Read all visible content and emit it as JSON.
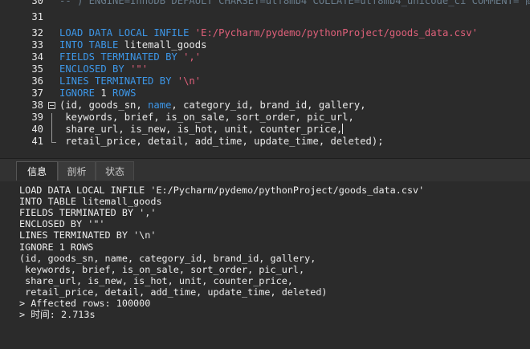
{
  "editor": {
    "lines": [
      {
        "num": "30",
        "segments": [
          {
            "t": "-- ) ENGINE=InnoDB DEFAULT CHARSET=utf8mb4 COLLATE=utf8mb4_unicode_ci COMMENT='商品表';",
            "c": "cmt"
          }
        ]
      },
      {
        "num": "31",
        "segments": []
      },
      {
        "num": "32",
        "segments": [
          {
            "t": "LOAD DATA LOCAL INFILE ",
            "c": "kw"
          },
          {
            "t": "'E:/Pycharm/pydemo/pythonProject/goods_data.csv'",
            "c": "str"
          }
        ]
      },
      {
        "num": "33",
        "segments": [
          {
            "t": "INTO TABLE ",
            "c": "kw"
          },
          {
            "t": "litemall_goods",
            "c": "plain"
          }
        ]
      },
      {
        "num": "34",
        "segments": [
          {
            "t": "FIELDS TERMINATED BY ",
            "c": "kw"
          },
          {
            "t": "','",
            "c": "str"
          }
        ]
      },
      {
        "num": "35",
        "segments": [
          {
            "t": "ENCLOSED BY ",
            "c": "kw"
          },
          {
            "t": "'\"'",
            "c": "str"
          }
        ]
      },
      {
        "num": "36",
        "segments": [
          {
            "t": "LINES TERMINATED BY ",
            "c": "kw"
          },
          {
            "t": "'\\n'",
            "c": "str"
          }
        ]
      },
      {
        "num": "37",
        "segments": [
          {
            "t": "IGNORE ",
            "c": "kw"
          },
          {
            "t": "1",
            "c": "num"
          },
          {
            "t": " ROWS",
            "c": "kw"
          }
        ]
      },
      {
        "num": "38",
        "segments": [
          {
            "t": "(id, goods_sn, ",
            "c": "plain"
          },
          {
            "t": "name",
            "c": "kw"
          },
          {
            "t": ", category_id, brand_id, gallery,",
            "c": "plain"
          }
        ]
      },
      {
        "num": "39",
        "segments": [
          {
            "t": " keywords, brief, is_on_sale, sort_order, pic_url,",
            "c": "plain"
          }
        ]
      },
      {
        "num": "40",
        "segments": [
          {
            "t": " share_url, is_new, is_hot, unit, counter_price,",
            "c": "plain"
          }
        ]
      },
      {
        "num": "41",
        "segments": [
          {
            "t": " retail_price, detail, add_time, update_time, deleted);",
            "c": "plain"
          }
        ]
      }
    ]
  },
  "tabs": [
    "信息",
    "剖析",
    "状态"
  ],
  "output": {
    "lines": [
      "LOAD DATA LOCAL INFILE 'E:/Pycharm/pydemo/pythonProject/goods_data.csv'",
      "INTO TABLE litemall_goods",
      "FIELDS TERMINATED BY ','",
      "ENCLOSED BY '\"'",
      "LINES TERMINATED BY '\\n'",
      "IGNORE 1 ROWS",
      "(id, goods_sn, name, category_id, brand_id, gallery,",
      " keywords, brief, is_on_sale, sort_order, pic_url,",
      " share_url, is_new, is_hot, unit, counter_price,",
      " retail_price, detail, add_time, update_time, deleted)",
      "> Affected rows: 100000",
      "> 时间: 2.713s"
    ]
  }
}
